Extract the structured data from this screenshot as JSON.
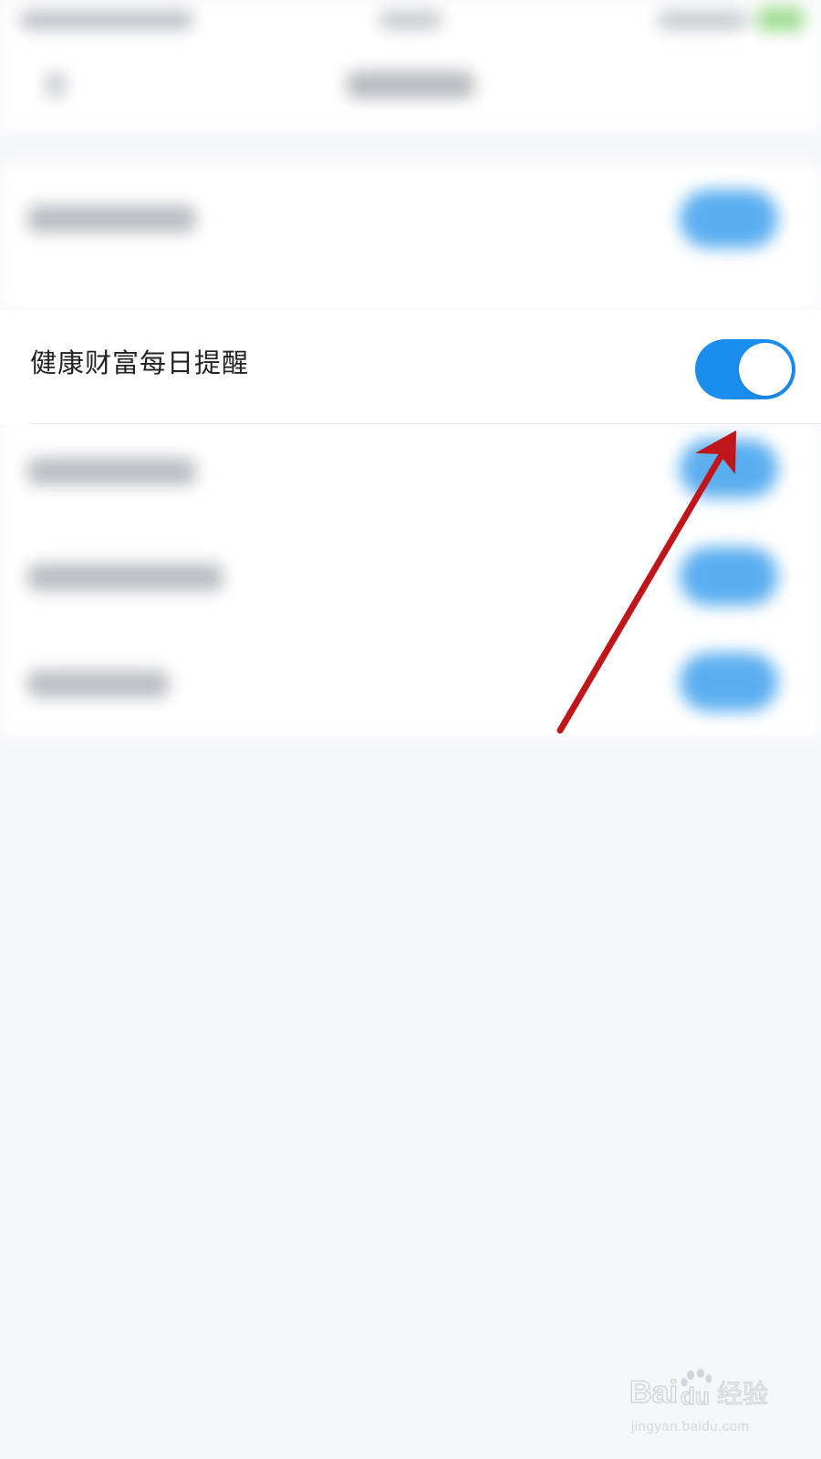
{
  "setting": {
    "label": "健康财富每日提醒",
    "toggle_state": "on"
  },
  "colors": {
    "toggle_on": "#1a8def",
    "annotation_arrow": "#c0161b",
    "page_background": "#f5f6f8"
  },
  "annotation": {
    "icon": "arrow-pointer",
    "target": "setting-toggle"
  },
  "watermark": {
    "brand": "Baidu经验",
    "url": "jingyan.baidu.com"
  }
}
